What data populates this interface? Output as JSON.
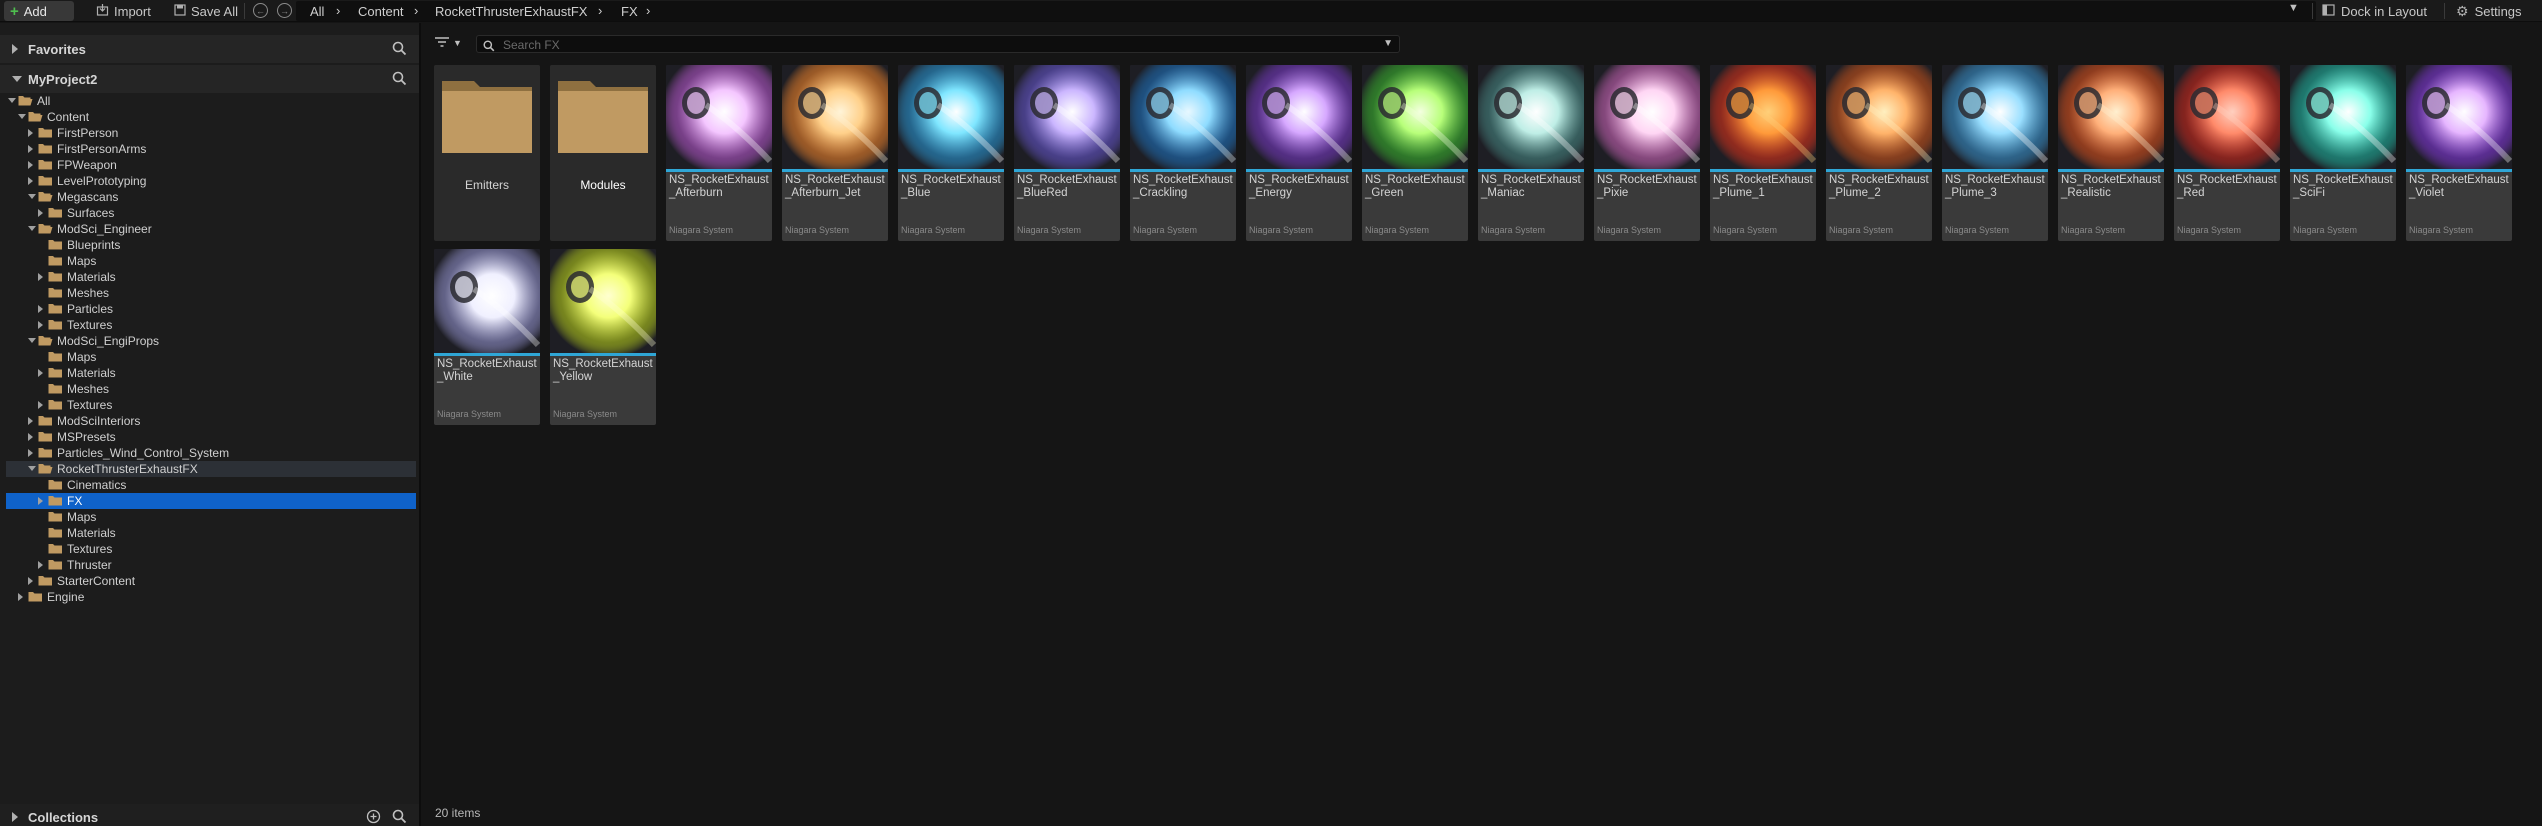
{
  "toolbar": {
    "add_label": "Add",
    "import_label": "Import",
    "save_all_label": "Save All",
    "breadcrumbs": [
      "All",
      "Content",
      "RocketThrusterExhaustFX",
      "FX"
    ],
    "dock_label": "Dock in Layout",
    "settings_label": "Settings"
  },
  "left_panel": {
    "favorites_label": "Favorites",
    "project_label": "MyProject2",
    "collections_label": "Collections",
    "tree": [
      {
        "label": "All",
        "depth": 0,
        "expander": "down",
        "icon": "folder-open"
      },
      {
        "label": "Content",
        "depth": 1,
        "expander": "down",
        "icon": "folder-open"
      },
      {
        "label": "FirstPerson",
        "depth": 2,
        "expander": "right",
        "icon": "folder"
      },
      {
        "label": "FirstPersonArms",
        "depth": 2,
        "expander": "right",
        "icon": "folder"
      },
      {
        "label": "FPWeapon",
        "depth": 2,
        "expander": "right",
        "icon": "folder"
      },
      {
        "label": "LevelPrototyping",
        "depth": 2,
        "expander": "right",
        "icon": "folder"
      },
      {
        "label": "Megascans",
        "depth": 2,
        "expander": "down",
        "icon": "folder-open"
      },
      {
        "label": "Surfaces",
        "depth": 3,
        "expander": "right",
        "icon": "folder"
      },
      {
        "label": "ModSci_Engineer",
        "depth": 2,
        "expander": "down",
        "icon": "folder-open"
      },
      {
        "label": "Blueprints",
        "depth": 3,
        "expander": "none",
        "icon": "folder"
      },
      {
        "label": "Maps",
        "depth": 3,
        "expander": "none",
        "icon": "folder"
      },
      {
        "label": "Materials",
        "depth": 3,
        "expander": "right",
        "icon": "folder"
      },
      {
        "label": "Meshes",
        "depth": 3,
        "expander": "none",
        "icon": "folder"
      },
      {
        "label": "Particles",
        "depth": 3,
        "expander": "right",
        "icon": "folder"
      },
      {
        "label": "Textures",
        "depth": 3,
        "expander": "right",
        "icon": "folder"
      },
      {
        "label": "ModSci_EngiProps",
        "depth": 2,
        "expander": "down",
        "icon": "folder-open"
      },
      {
        "label": "Maps",
        "depth": 3,
        "expander": "none",
        "icon": "folder"
      },
      {
        "label": "Materials",
        "depth": 3,
        "expander": "right",
        "icon": "folder"
      },
      {
        "label": "Meshes",
        "depth": 3,
        "expander": "none",
        "icon": "folder"
      },
      {
        "label": "Textures",
        "depth": 3,
        "expander": "right",
        "icon": "folder"
      },
      {
        "label": "ModSciInteriors",
        "depth": 2,
        "expander": "right",
        "icon": "folder"
      },
      {
        "label": "MSPresets",
        "depth": 2,
        "expander": "right",
        "icon": "folder"
      },
      {
        "label": "Particles_Wind_Control_System",
        "depth": 2,
        "expander": "right",
        "icon": "folder"
      },
      {
        "label": "RocketThrusterExhaustFX",
        "depth": 2,
        "expander": "down",
        "icon": "folder-open",
        "state": "parent"
      },
      {
        "label": "Cinematics",
        "depth": 3,
        "expander": "none",
        "icon": "folder"
      },
      {
        "label": "FX",
        "depth": 3,
        "expander": "right",
        "icon": "folder",
        "state": "selected"
      },
      {
        "label": "Maps",
        "depth": 3,
        "expander": "none",
        "icon": "folder"
      },
      {
        "label": "Materials",
        "depth": 3,
        "expander": "none",
        "icon": "folder"
      },
      {
        "label": "Textures",
        "depth": 3,
        "expander": "none",
        "icon": "folder"
      },
      {
        "label": "Thruster",
        "depth": 3,
        "expander": "right",
        "icon": "folder"
      },
      {
        "label": "StarterContent",
        "depth": 2,
        "expander": "right",
        "icon": "folder"
      },
      {
        "label": "Engine",
        "depth": 1,
        "expander": "right",
        "icon": "folder"
      }
    ]
  },
  "content": {
    "search_placeholder": "Search FX",
    "item_count": "20 items",
    "type_label": "Niagara System",
    "folders": [
      {
        "name": "Emitters"
      },
      {
        "name": "Modules"
      }
    ],
    "assets": [
      {
        "name": "NS_RocketExhaust_Afterburn",
        "colors": [
          "#f4c6ff",
          "#c05bd8",
          "#ffffff"
        ]
      },
      {
        "name": "NS_RocketExhaust_Afterburn_Jet",
        "colors": [
          "#ffd08a",
          "#ff8a2a",
          "#fff4d8"
        ]
      },
      {
        "name": "NS_RocketExhaust_Blue",
        "colors": [
          "#7fe6ff",
          "#2a9fe0",
          "#ffffff"
        ]
      },
      {
        "name": "NS_RocketExhaust_BlueRed",
        "colors": [
          "#cbb6ff",
          "#6a5ad8",
          "#ffffff"
        ]
      },
      {
        "name": "NS_RocketExhaust_Crackling",
        "colors": [
          "#8fdcff",
          "#1f78c8",
          "#e8f8ff"
        ]
      },
      {
        "name": "NS_RocketExhaust_Energy",
        "colors": [
          "#d6a8ff",
          "#7e3ccf",
          "#ffffff"
        ]
      },
      {
        "name": "NS_RocketExhaust_Green",
        "colors": [
          "#b8ff7a",
          "#3bbf2e",
          "#f4ffe0"
        ]
      },
      {
        "name": "NS_RocketExhaust_Maniac",
        "colors": [
          "#bfeee6",
          "#4a8f8a",
          "#ffffff"
        ]
      },
      {
        "name": "NS_RocketExhaust_Pixie",
        "colors": [
          "#ffd6f4",
          "#d86ac4",
          "#ffffff"
        ]
      },
      {
        "name": "NS_RocketExhaust_Plume_1",
        "colors": [
          "#ff9a3a",
          "#e8341a",
          "#ffd07a"
        ]
      },
      {
        "name": "NS_RocketExhaust_Plume_2",
        "colors": [
          "#ffb36a",
          "#d8581a",
          "#fff0c0"
        ]
      },
      {
        "name": "NS_RocketExhaust_Plume_3",
        "colors": [
          "#9adfff",
          "#3a9ad8",
          "#ffffff"
        ]
      },
      {
        "name": "NS_RocketExhaust_Realistic",
        "colors": [
          "#ffb07a",
          "#e8541a",
          "#fff0d0"
        ]
      },
      {
        "name": "NS_RocketExhaust_Red",
        "colors": [
          "#ff8a6a",
          "#d8281a",
          "#ffd0c0"
        ]
      },
      {
        "name": "NS_RocketExhaust_SciFi",
        "colors": [
          "#8affea",
          "#1fbfa8",
          "#ffffff"
        ]
      },
      {
        "name": "NS_RocketExhaust_Violet",
        "colors": [
          "#e6b6ff",
          "#8a3ae8",
          "#ffffff"
        ]
      },
      {
        "name": "NS_RocketExhaust_White",
        "colors": [
          "#f0f0ff",
          "#9a9ad8",
          "#ffffff"
        ]
      },
      {
        "name": "NS_RocketExhaust_Yellow",
        "colors": [
          "#f4ff7a",
          "#bfd81a",
          "#ffffd0"
        ]
      }
    ]
  },
  "colors": {
    "selection": "#0f62c9",
    "asset_bar": "#2fa6d6",
    "folder": "#c09a62",
    "add_plus": "#4fbf4f"
  }
}
